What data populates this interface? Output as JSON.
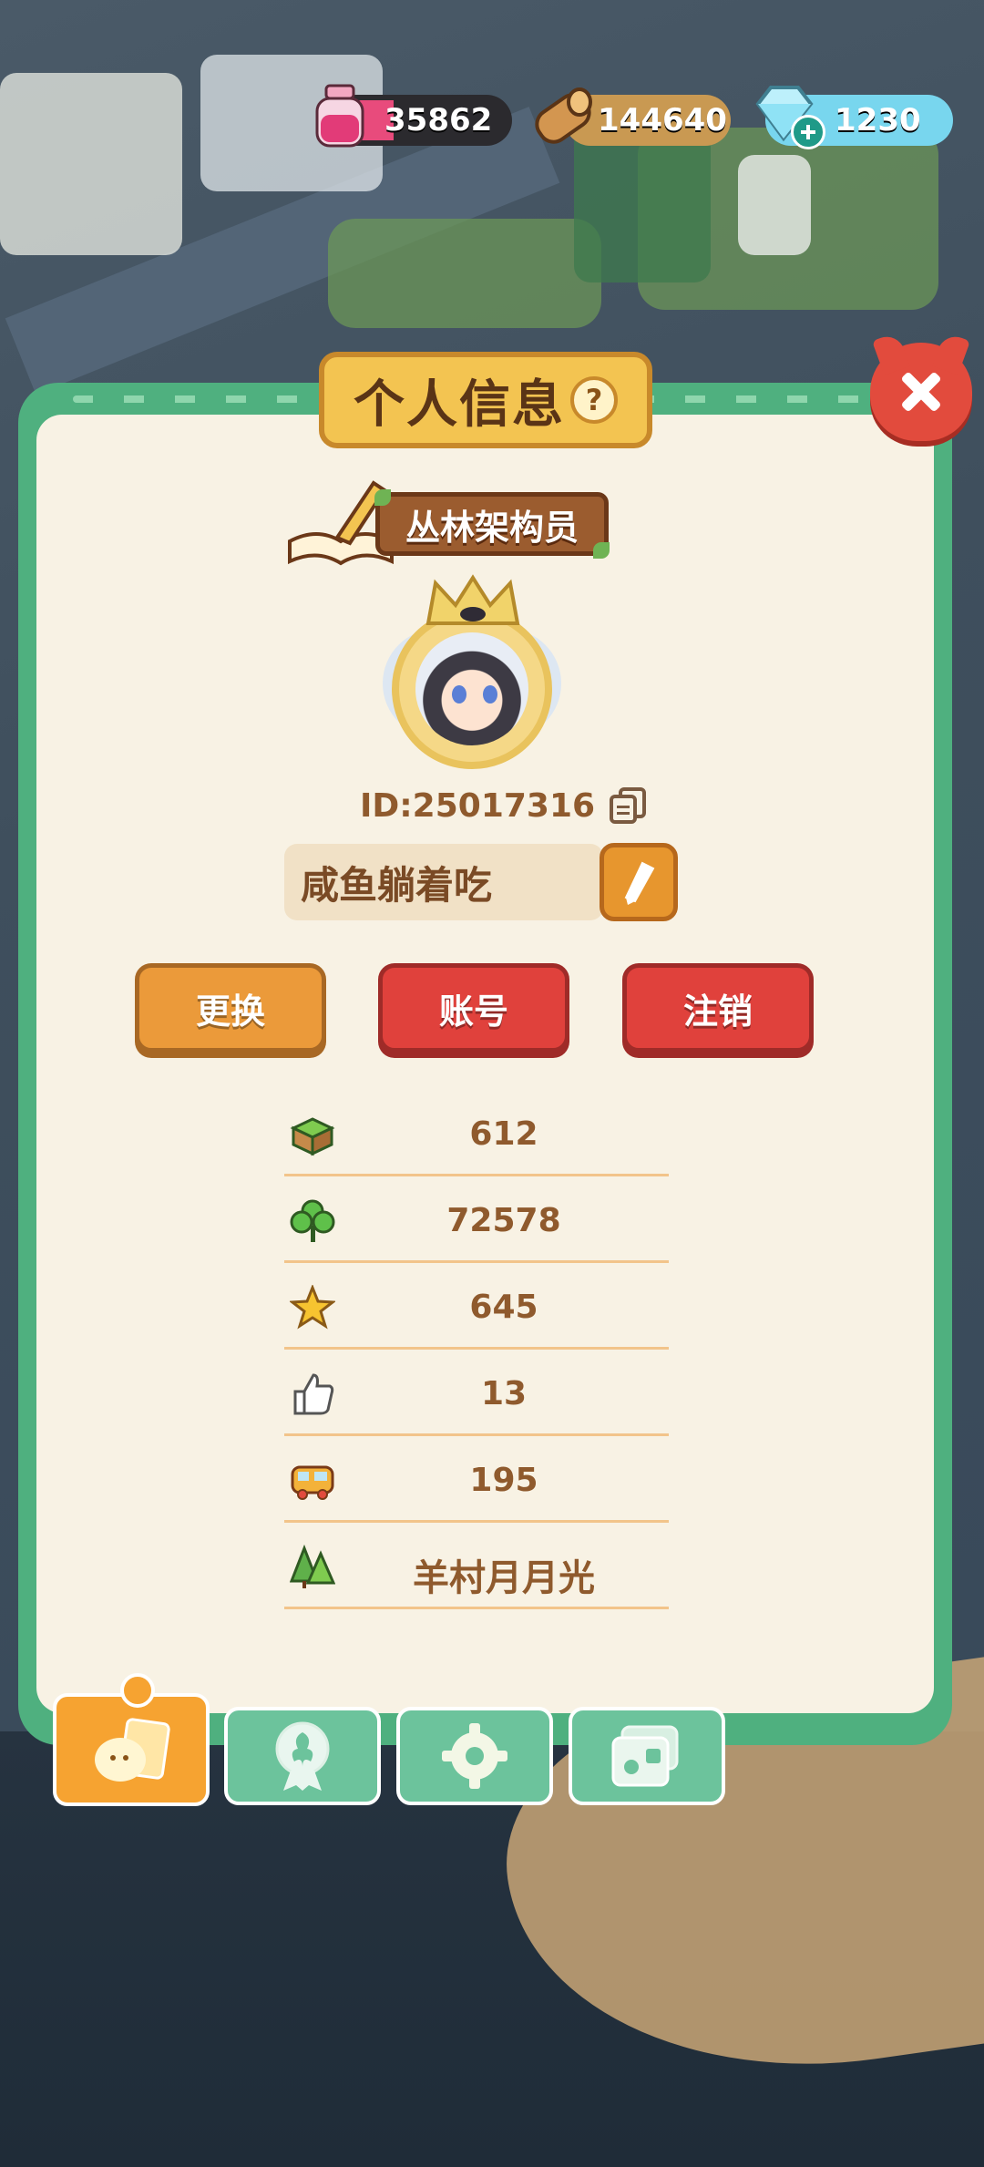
{
  "resources": {
    "ink": {
      "value": "35862",
      "fill_fraction": 0.2,
      "icon": "ink-bottle-icon",
      "color": "#e84b7c"
    },
    "wood": {
      "value": "144640",
      "icon": "wood-log-icon",
      "color": "#c99952"
    },
    "gems": {
      "value": "1230",
      "icon": "diamond-icon",
      "add_icon": "plus-icon",
      "color": "#78d6ee"
    }
  },
  "panel": {
    "title": "个人信息",
    "help_glyph": "?",
    "close_icon": "close-icon"
  },
  "profile": {
    "rank_title": "丛林架构员",
    "id_text": "ID:25017316",
    "nickname": "咸鱼躺着吃",
    "buttons": {
      "change": "更换",
      "account": "账号",
      "logout": "注销"
    }
  },
  "stats": [
    {
      "icon": "grass-block-icon",
      "value": "612"
    },
    {
      "icon": "clover-icon",
      "value": "72578"
    },
    {
      "icon": "star-icon",
      "value": "645"
    },
    {
      "icon": "thumbs-up-icon",
      "value": "13"
    },
    {
      "icon": "bus-icon",
      "value": "195"
    },
    {
      "icon": "pine-trees-icon",
      "value": "羊村月月光"
    }
  ],
  "tabs": [
    {
      "name": "profile-card",
      "icon": "profile-card-icon",
      "active": true
    },
    {
      "name": "badge",
      "icon": "badge-icon",
      "active": false
    },
    {
      "name": "settings",
      "icon": "gear-icon",
      "active": false
    },
    {
      "name": "album",
      "icon": "album-icon",
      "active": false
    }
  ],
  "colors": {
    "panel_green": "#4fb07f",
    "panel_cream": "#f8f2e4",
    "title_gold": "#f3c451",
    "btn_orange": "#eb9a3a",
    "btn_red": "#e0413c",
    "text_brown": "#8f5a2d"
  }
}
